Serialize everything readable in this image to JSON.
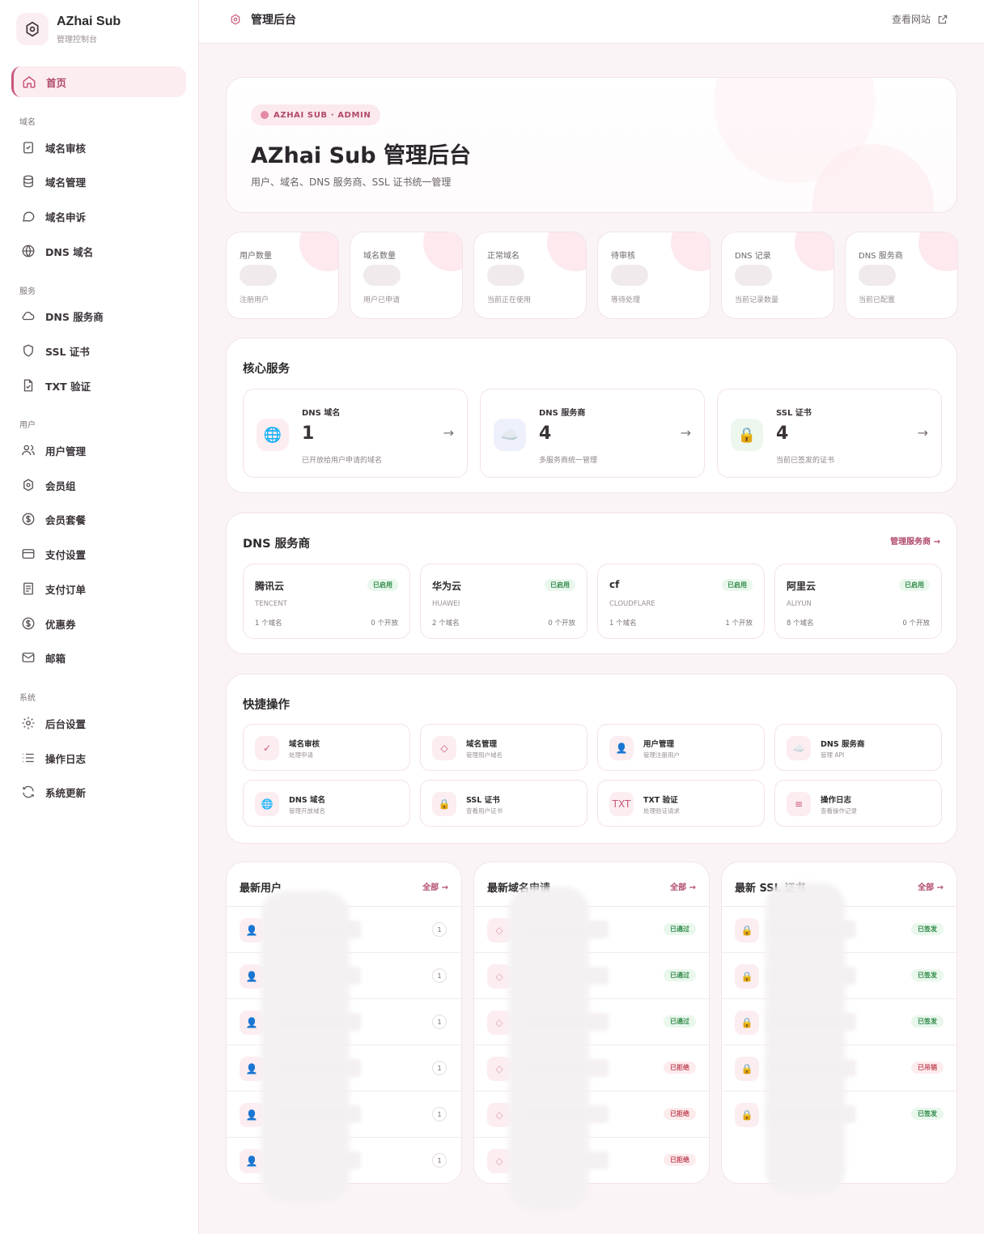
{
  "brand": {
    "title": "AZhai Sub",
    "subtitle": "管理控制台",
    "accent": "#c9577a"
  },
  "sidebar": {
    "home": "首页",
    "sections": [
      {
        "title": "域名",
        "items": [
          {
            "label": "域名审核",
            "icon": "clipboard-check-icon"
          },
          {
            "label": "域名管理",
            "icon": "database-icon"
          },
          {
            "label": "域名申诉",
            "icon": "message-circle-icon"
          },
          {
            "label": "DNS 域名",
            "icon": "globe-icon"
          }
        ]
      },
      {
        "title": "服务",
        "items": [
          {
            "label": "DNS 服务商",
            "icon": "cloud-icon"
          },
          {
            "label": "SSL 证书",
            "icon": "shield-icon"
          },
          {
            "label": "TXT 验证",
            "icon": "file-check-icon"
          }
        ]
      },
      {
        "title": "用户",
        "items": [
          {
            "label": "用户管理",
            "icon": "users-icon"
          },
          {
            "label": "会员组",
            "icon": "users-group-icon"
          },
          {
            "label": "会员套餐",
            "icon": "dollar-circle-icon"
          },
          {
            "label": "支付设置",
            "icon": "credit-card-icon"
          },
          {
            "label": "支付订单",
            "icon": "receipt-icon"
          },
          {
            "label": "优惠券",
            "icon": "coupon-icon"
          },
          {
            "label": "邮箱",
            "icon": "mail-icon"
          }
        ]
      },
      {
        "title": "系统",
        "items": [
          {
            "label": "后台设置",
            "icon": "gear-icon"
          },
          {
            "label": "操作日志",
            "icon": "list-icon"
          },
          {
            "label": "系统更新",
            "icon": "refresh-icon"
          }
        ]
      }
    ]
  },
  "topbar": {
    "title": "管理后台",
    "link": "查看网站"
  },
  "hero": {
    "badge": "AZHAI SUB · ADMIN",
    "title": "AZhai Sub 管理后台",
    "subtitle": "用户、域名、DNS 服务商、SSL 证书统一管理"
  },
  "stats": [
    {
      "label": "用户数量",
      "sub": "注册用户"
    },
    {
      "label": "域名数量",
      "sub": "用户已申请"
    },
    {
      "label": "正常域名",
      "sub": "当前正在使用"
    },
    {
      "label": "待审核",
      "sub": "等待处理"
    },
    {
      "label": "DNS 记录",
      "sub": "当前记录数量"
    },
    {
      "label": "DNS 服务商",
      "sub": "当前已配置"
    }
  ],
  "core": {
    "title": "核心服务",
    "items": [
      {
        "label": "DNS 域名",
        "value": "1",
        "sub": "已开放给用户申请的域名",
        "icon": "🌐",
        "arrow": "→"
      },
      {
        "label": "DNS 服务商",
        "value": "4",
        "sub": "多服务商统一管理",
        "icon": "☁️",
        "arrow": "→"
      },
      {
        "label": "SSL 证书",
        "value": "4",
        "sub": "当前已签发的证书",
        "icon": "🔒",
        "arrow": "→"
      }
    ]
  },
  "providers": {
    "title": "DNS 服务商",
    "link": "管理服务商 →",
    "items": [
      {
        "name": "腾讯云",
        "code": "TENCENT",
        "domains": "1 个域名",
        "open": "0 个开放",
        "status": "已启用"
      },
      {
        "name": "华为云",
        "code": "HUAWEI",
        "domains": "2 个域名",
        "open": "0 个开放",
        "status": "已启用"
      },
      {
        "name": "cf",
        "code": "CLOUDFLARE",
        "domains": "1 个域名",
        "open": "1 个开放",
        "status": "已启用"
      },
      {
        "name": "阿里云",
        "code": "ALIYUN",
        "domains": "8 个域名",
        "open": "0 个开放",
        "status": "已启用"
      }
    ]
  },
  "quick": {
    "title": "快捷操作",
    "items": [
      {
        "label": "域名审核",
        "sub": "处理申请",
        "icon": "✓"
      },
      {
        "label": "域名管理",
        "sub": "管理用户域名",
        "icon": "◇"
      },
      {
        "label": "用户管理",
        "sub": "管理注册用户",
        "icon": "👤"
      },
      {
        "label": "DNS 服务商",
        "sub": "管理 API",
        "icon": "☁️"
      },
      {
        "label": "DNS 域名",
        "sub": "管理开放域名",
        "icon": "🌐"
      },
      {
        "label": "SSL 证书",
        "sub": "查看用户证书",
        "icon": "🔒"
      },
      {
        "label": "TXT 验证",
        "sub": "处理验证请求",
        "icon": "TXT"
      },
      {
        "label": "操作日志",
        "sub": "查看操作记录",
        "icon": "≡"
      }
    ]
  },
  "latest_users": {
    "title": "最新用户",
    "link": "全部 →",
    "rows": [
      {
        "icon": "👤",
        "count": "1"
      },
      {
        "icon": "👤",
        "count": "1"
      },
      {
        "icon": "👤",
        "count": "1"
      },
      {
        "icon": "👤",
        "count": "1"
      },
      {
        "icon": "👤",
        "count": "1"
      },
      {
        "icon": "👤",
        "count": "1"
      }
    ]
  },
  "latest_domains": {
    "title": "最新域名申请",
    "link": "全部 →",
    "rows": [
      {
        "icon": "◇",
        "status": "已通过",
        "ok": true
      },
      {
        "icon": "◇",
        "status": "已通过",
        "ok": true
      },
      {
        "icon": "◇",
        "status": "已通过",
        "ok": true
      },
      {
        "icon": "◇",
        "status": "已拒绝",
        "ok": false
      },
      {
        "icon": "◇",
        "status": "已拒绝",
        "ok": false
      },
      {
        "icon": "◇",
        "status": "已拒绝",
        "ok": false
      }
    ]
  },
  "latest_ssl": {
    "title": "最新 SSL 证书",
    "link": "全部 →",
    "rows": [
      {
        "icon": "🔒",
        "status": "已签发",
        "ok": true
      },
      {
        "icon": "🔒",
        "status": "已签发",
        "ok": true
      },
      {
        "icon": "🔒",
        "status": "已签发",
        "ok": true
      },
      {
        "icon": "🔒",
        "status": "已吊销",
        "ok": false
      },
      {
        "icon": "🔒",
        "status": "已签发",
        "ok": true
      }
    ]
  }
}
